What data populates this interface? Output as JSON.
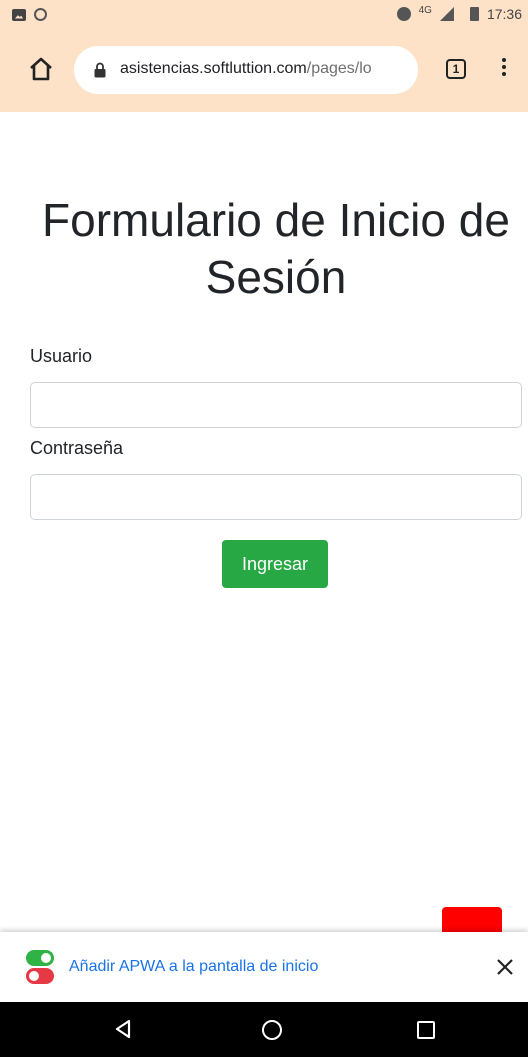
{
  "status_bar": {
    "time": "17:36",
    "network": "4G"
  },
  "browser": {
    "url_host": "asistencias.softluttion.com",
    "url_path": "/pages/lo",
    "tab_count": "1"
  },
  "form": {
    "title": "Formulario de Inicio de Sesión",
    "username_label": "Usuario",
    "username_value": "",
    "password_label": "Contraseña",
    "password_value": "",
    "submit_label": "Ingresar"
  },
  "install_banner": {
    "text": "Añadir APWA a la pantalla de inicio"
  },
  "colors": {
    "toolbar_bg": "#fde2c8",
    "submit_bg": "#28a745",
    "banner_link": "#1a73e8",
    "fab_red": "#ff0000"
  }
}
